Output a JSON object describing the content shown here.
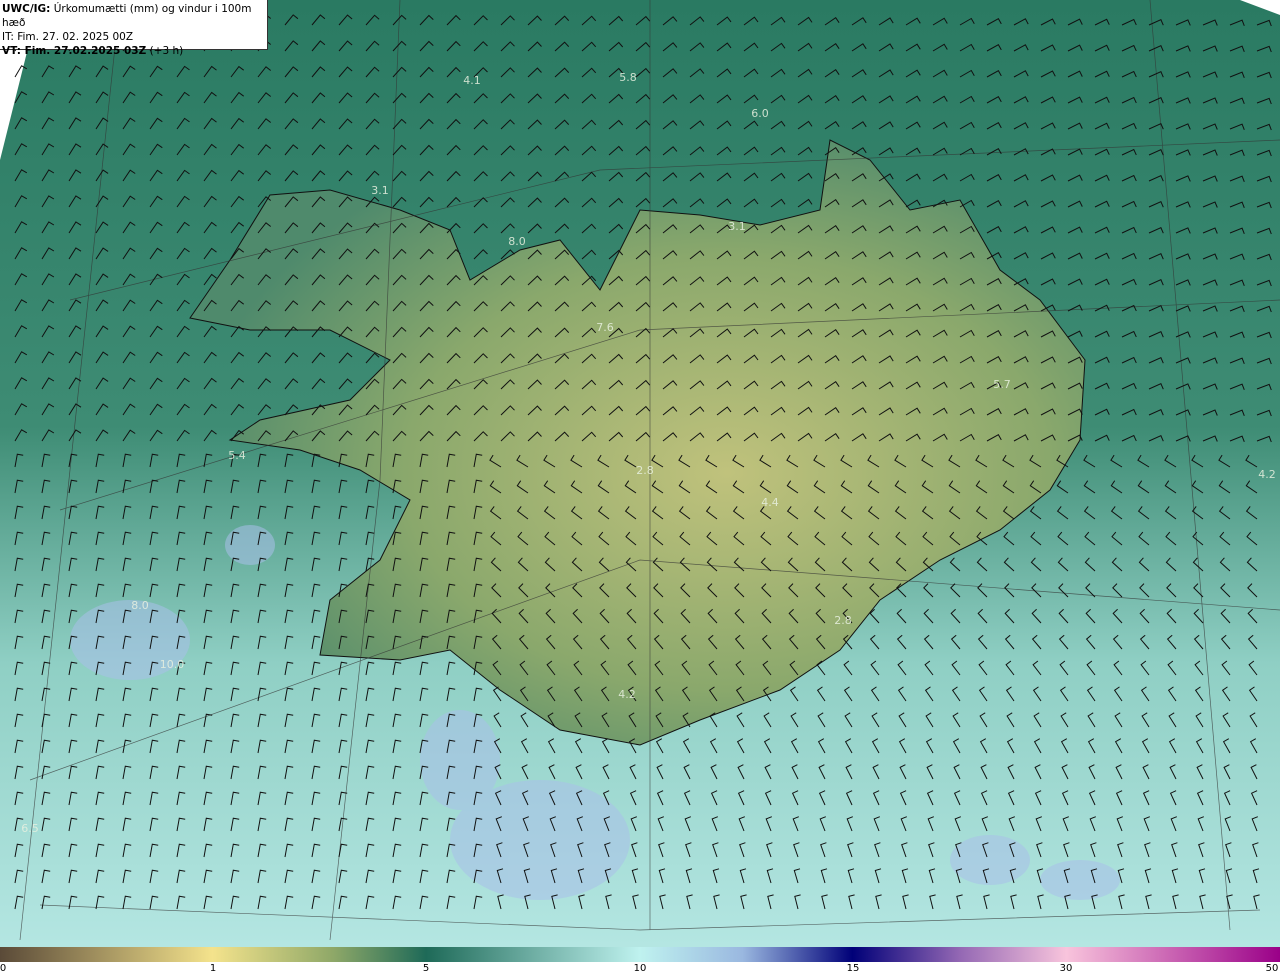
{
  "header": {
    "model": "UWC/IG:",
    "title": "Úrkomumætti (mm) og vindur i 100m hæð",
    "it_line": "IT: Fim. 27. 02. 2025 00Z",
    "vt_prefix": "VT: Fim. 27.02.2025 03Z",
    "vt_offset": "(+3 h)"
  },
  "map_labels": [
    {
      "text": "4.1",
      "lon_lat": "NW sea"
    },
    {
      "text": "5.8"
    },
    {
      "text": "6.0"
    },
    {
      "text": "3.1"
    },
    {
      "text": "8.0"
    },
    {
      "text": "3.1"
    },
    {
      "text": "7.6"
    },
    {
      "text": "5.7"
    },
    {
      "text": "4.2"
    },
    {
      "text": "5.4"
    },
    {
      "text": "2.8"
    },
    {
      "text": "4.4"
    },
    {
      "text": "2.8"
    },
    {
      "text": "4.2"
    },
    {
      "text": "6.5"
    },
    {
      "text": "8.0"
    },
    {
      "text": "10.0"
    }
  ],
  "colorbar": {
    "ticks": [
      "0",
      "1",
      "5",
      "10",
      "15",
      "30",
      "50"
    ],
    "colors": [
      "#5a4a38",
      "#f4e38c",
      "#8fa868",
      "#1e6a58",
      "#bff2ef",
      "#9ab8e0",
      "#000078",
      "#9468b4",
      "#f8c4dc",
      "#9a0088"
    ]
  }
}
